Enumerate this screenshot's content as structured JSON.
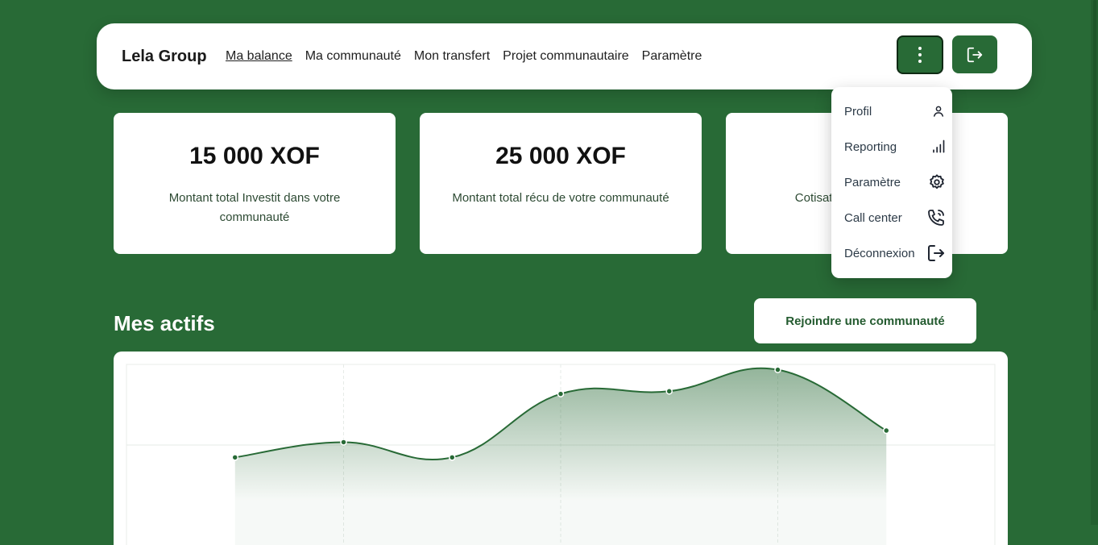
{
  "header": {
    "brand": "Lela Group",
    "nav": [
      {
        "label": "Ma balance",
        "active": true
      },
      {
        "label": "Ma communauté"
      },
      {
        "label": "Mon transfert"
      },
      {
        "label": "Projet communautaire"
      },
      {
        "label": "Paramètre"
      }
    ],
    "kebab_icon": "dots-vertical-icon",
    "logout_icon": "logout-icon"
  },
  "cards": [
    {
      "amount": "15 000 XOF",
      "description": "Montant total Investit dans votre communauté"
    },
    {
      "amount": "25 000 XOF",
      "description": "Montant total récu de votre communauté"
    },
    {
      "amount": "",
      "description": "Cotisation en … dans la …"
    }
  ],
  "dropdown": {
    "items": [
      {
        "label": "Profil",
        "icon": "user-icon"
      },
      {
        "label": "Reporting",
        "icon": "bar-chart-icon"
      },
      {
        "label": "Paramètre",
        "icon": "gear-icon"
      },
      {
        "label": "Call center",
        "icon": "phone-call-icon"
      },
      {
        "label": "Déconnexion",
        "icon": "logout-icon"
      }
    ]
  },
  "assets": {
    "title": "Mes actifs",
    "join_button": "Rejoindre une communauté"
  },
  "chart_data": {
    "type": "area",
    "title": "",
    "xlabel": "",
    "ylabel": "",
    "values": [
      28,
      45,
      28,
      99,
      102,
      126,
      58
    ],
    "ylim": [
      -70,
      132
    ],
    "grid": true,
    "color": "#286a36"
  },
  "colors": {
    "brand_green": "#286a36",
    "card_background": "#ffffff",
    "text_dark": "#111111"
  }
}
